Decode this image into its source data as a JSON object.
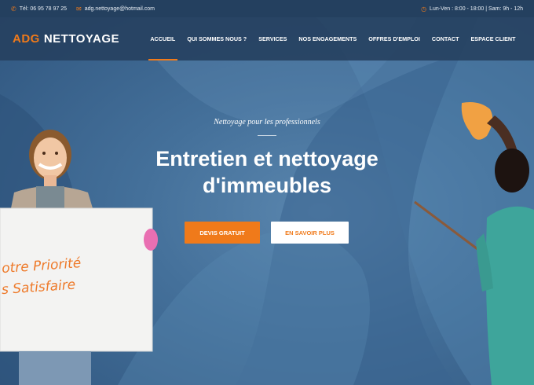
{
  "topbar": {
    "phone": "Tél: 06 95 78 97 25",
    "email": "adg.nettoyage@hotmail.com",
    "hours": "Lun-Ven : 8:00 - 18:00 | Sam: 9h - 12h",
    "phone_icon": "phone-icon",
    "email_icon": "envelope-icon",
    "hours_icon": "clock-icon"
  },
  "brand": {
    "logo_part1": "ADG",
    "logo_part2": "NETTOYAGE"
  },
  "nav": {
    "items": [
      {
        "label": "ACCUEIL"
      },
      {
        "label": "QUI SOMMES NOUS ?"
      },
      {
        "label": "SERVICES"
      },
      {
        "label": "NOS ENGAGEMENTS"
      },
      {
        "label": "OFFRES D'EMPLOI"
      },
      {
        "label": "CONTACT"
      },
      {
        "label": "ESPACE CLIENT"
      }
    ],
    "active": "ACCUEIL"
  },
  "hero": {
    "tagline": "Nettoyage pour les professionnels",
    "title_line1": "Entretien et nettoyage",
    "title_line2": "d'immeubles",
    "primary_button": "DEVIS GRATUIT",
    "secondary_button": "EN SAVOIR PLUS",
    "sign_line1": "otre Priorité",
    "sign_line2": "s Satisfaire"
  },
  "colors": {
    "accent": "#f07a1a",
    "navbar": "#26405e",
    "topbar": "#24405f",
    "hero_bg": "#44709a"
  }
}
